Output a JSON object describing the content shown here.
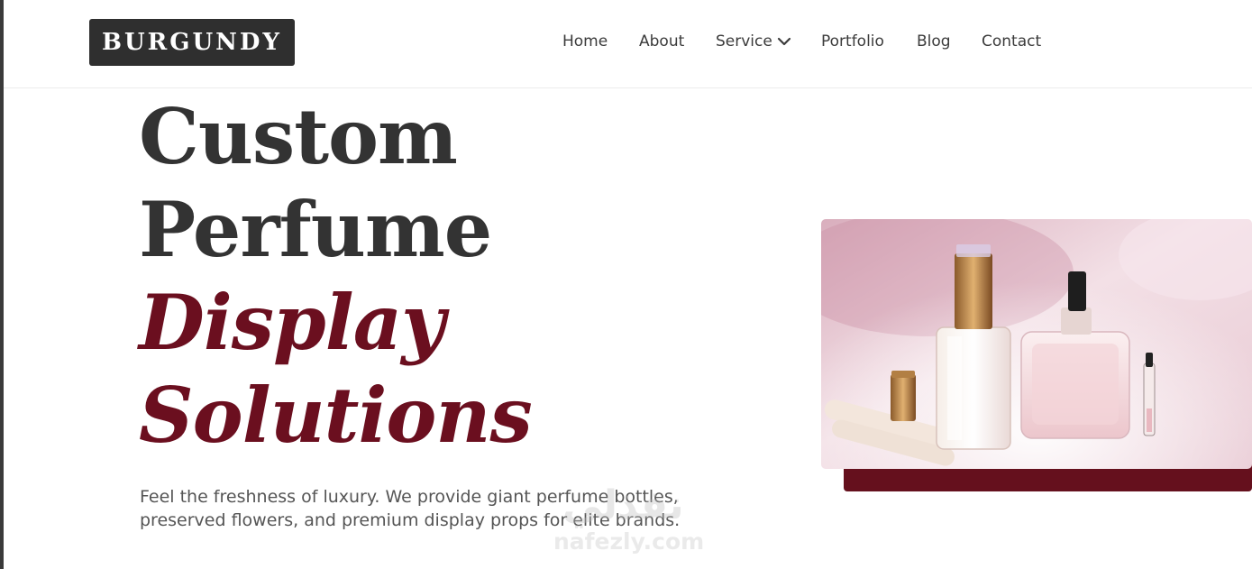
{
  "brand": {
    "logo_text": "BURGUNDY"
  },
  "nav": {
    "items": [
      {
        "label": "Home"
      },
      {
        "label": "About"
      },
      {
        "label": "Service"
      },
      {
        "label": "Portfolio"
      },
      {
        "label": "Blog"
      },
      {
        "label": "Contact"
      }
    ]
  },
  "hero": {
    "title_line1": "Custom",
    "title_line2": "Perfume",
    "title_line3": "Display",
    "title_line4": "Solutions",
    "description": "Feel the freshness of luxury. We provide giant perfume bottles, preserved flowers, and premium display props for elite brands."
  },
  "watermark": {
    "arabic": "نفذلي",
    "latin": "nafezly.com"
  },
  "colors": {
    "burgundy": "#65101d",
    "dark": "#333333",
    "logo_bg": "#2f2f2f"
  }
}
